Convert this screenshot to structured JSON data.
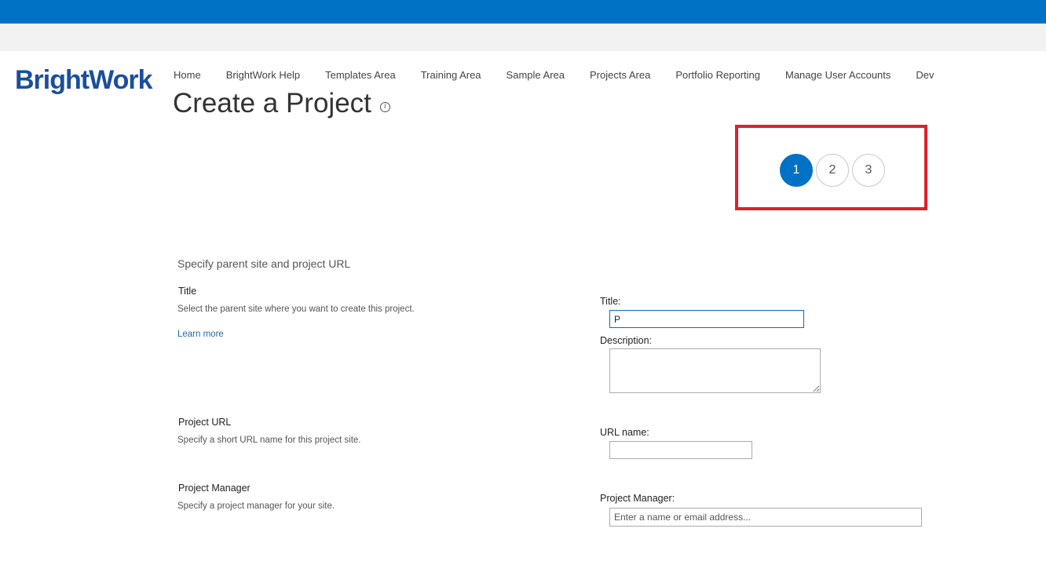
{
  "colors": {
    "top_bar": "#0072c6",
    "sub_bar": "#f2f2f2",
    "logo": "#1b4f9c",
    "accent": "#0072c6",
    "link": "#1f6aa5",
    "highlight": "#e0202b"
  },
  "logo": {
    "text": "BrightWork"
  },
  "nav": {
    "items": [
      {
        "label": "Home"
      },
      {
        "label": "BrightWork Help"
      },
      {
        "label": "Templates Area"
      },
      {
        "label": "Training Area"
      },
      {
        "label": "Sample Area"
      },
      {
        "label": "Projects Area"
      },
      {
        "label": "Portfolio Reporting"
      },
      {
        "label": "Manage User Accounts"
      },
      {
        "label": "Dev"
      }
    ]
  },
  "page": {
    "title": "Create a Project",
    "info_icon": "info-icon"
  },
  "wizard": {
    "current_step": 1,
    "steps": [
      {
        "label": "1"
      },
      {
        "label": "2"
      },
      {
        "label": "3"
      }
    ]
  },
  "form": {
    "section_heading": "Specify parent site and project URL",
    "title_section": {
      "label": "Title",
      "description": "Select the parent site where you want to create this project.",
      "learn_more": "Learn more"
    },
    "url_section": {
      "label": "Project URL",
      "description": "Specify a short URL name for this project site."
    },
    "manager_section": {
      "label": "Project Manager",
      "description": "Specify a project manager for your site."
    },
    "fields": {
      "title_label": "Title:",
      "title_value": "P",
      "description_label": "Description:",
      "description_value": "",
      "url_label": "URL name:",
      "url_value": "",
      "manager_label": "Project Manager:",
      "manager_placeholder": "Enter a name or email address..."
    }
  }
}
